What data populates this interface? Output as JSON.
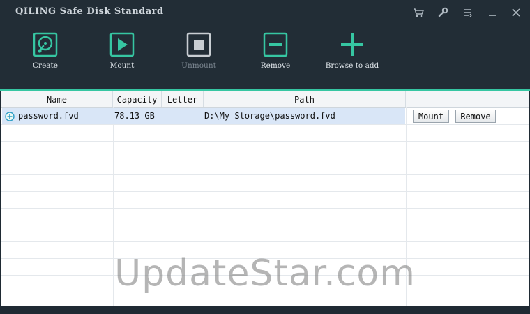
{
  "app": {
    "title": "QILING Safe Disk Standard"
  },
  "window_controls": [
    {
      "name": "cart-icon"
    },
    {
      "name": "wrench-icon"
    },
    {
      "name": "menu-icon"
    },
    {
      "name": "minimize-icon"
    },
    {
      "name": "close-icon"
    }
  ],
  "toolbar": {
    "create": "Create",
    "mount": "Mount",
    "unmount": "Unmount",
    "remove": "Remove",
    "browse": "Browse to add"
  },
  "colors": {
    "accent": "#36c6a2",
    "toolbar_bg": "#222d36",
    "selected_row": "#d9e6f7"
  },
  "table": {
    "columns": [
      "Name",
      "Capacity",
      "Letter",
      "Path"
    ],
    "rows": [
      {
        "name": "password.fvd",
        "capacity": "78.13 GB",
        "letter": "",
        "path": "D:\\My Storage\\password.fvd",
        "mount_label": "Mount",
        "remove_label": "Remove",
        "icon": "plus-circle-icon"
      }
    ]
  },
  "watermark": "UpdateStar.com"
}
